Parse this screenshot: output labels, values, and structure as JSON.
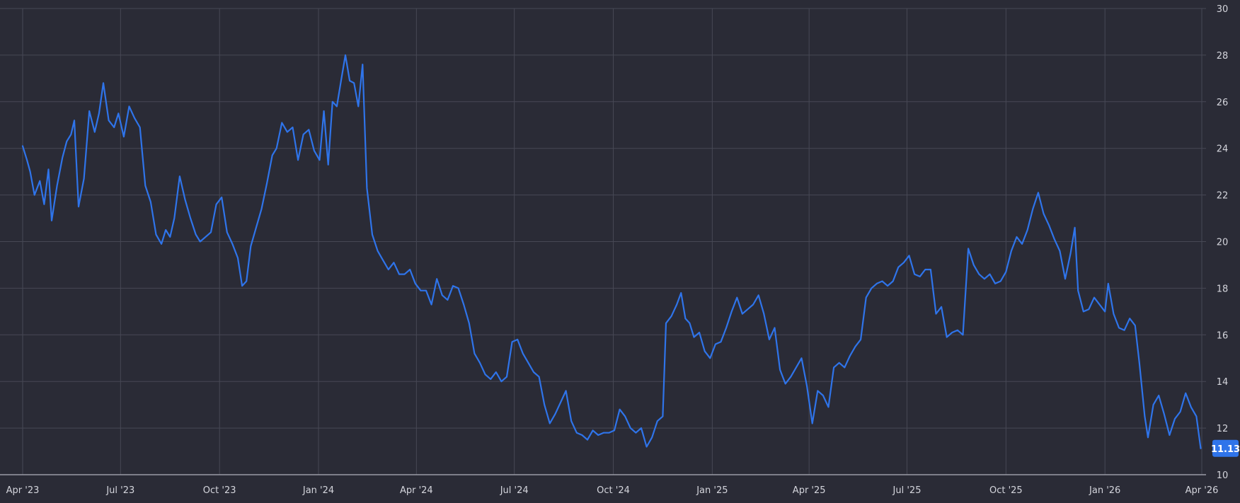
{
  "colors": {
    "background": "#2a2b36",
    "grid": "#474855",
    "line": "#2f74ea",
    "label": "#d4d5dc"
  },
  "chart_data": {
    "type": "line",
    "title": "",
    "xlabel": "",
    "ylabel": "",
    "ylim": [
      10,
      30
    ],
    "yticks": [
      10,
      12,
      14,
      16,
      18,
      20,
      22,
      24,
      26,
      28,
      30
    ],
    "xlim": [
      "2023-04-01",
      "2026-04-01"
    ],
    "xticks": [
      {
        "date": "2023-04-01",
        "label": "Apr '23"
      },
      {
        "date": "2023-07-01",
        "label": "Jul '23"
      },
      {
        "date": "2023-10-01",
        "label": "Oct '23"
      },
      {
        "date": "2024-01-01",
        "label": "Jan '24"
      },
      {
        "date": "2024-04-01",
        "label": "Apr '24"
      },
      {
        "date": "2024-07-01",
        "label": "Jul '24"
      },
      {
        "date": "2024-10-01",
        "label": "Oct '24"
      },
      {
        "date": "2025-01-01",
        "label": "Jan '25"
      },
      {
        "date": "2025-04-01",
        "label": "Apr '25"
      },
      {
        "date": "2025-07-01",
        "label": "Jul '25"
      },
      {
        "date": "2025-10-01",
        "label": "Oct '25"
      },
      {
        "date": "2026-01-01",
        "label": "Jan '26"
      },
      {
        "date": "2026-04-01",
        "label": "Apr '26"
      }
    ],
    "grid": true,
    "current_value": "11.13",
    "series": [
      {
        "points": [
          [
            "2023-04-01",
            24.1
          ],
          [
            "2023-04-05",
            23.5
          ],
          [
            "2023-04-08",
            23.0
          ],
          [
            "2023-04-12",
            22.0
          ],
          [
            "2023-04-17",
            22.6
          ],
          [
            "2023-04-21",
            21.6
          ],
          [
            "2023-04-25",
            23.1
          ],
          [
            "2023-04-28",
            20.9
          ],
          [
            "2023-05-03",
            22.4
          ],
          [
            "2023-05-08",
            23.6
          ],
          [
            "2023-05-12",
            24.3
          ],
          [
            "2023-05-16",
            24.6
          ],
          [
            "2023-05-19",
            25.2
          ],
          [
            "2023-05-23",
            21.5
          ],
          [
            "2023-05-28",
            22.7
          ],
          [
            "2023-06-02",
            25.6
          ],
          [
            "2023-06-07",
            24.7
          ],
          [
            "2023-06-11",
            25.5
          ],
          [
            "2023-06-15",
            26.8
          ],
          [
            "2023-06-20",
            25.2
          ],
          [
            "2023-06-25",
            24.9
          ],
          [
            "2023-06-29",
            25.5
          ],
          [
            "2023-07-04",
            24.5
          ],
          [
            "2023-07-09",
            25.8
          ],
          [
            "2023-07-14",
            25.3
          ],
          [
            "2023-07-19",
            24.9
          ],
          [
            "2023-07-24",
            22.4
          ],
          [
            "2023-07-29",
            21.7
          ],
          [
            "2023-08-03",
            20.3
          ],
          [
            "2023-08-08",
            19.9
          ],
          [
            "2023-08-12",
            20.5
          ],
          [
            "2023-08-16",
            20.2
          ],
          [
            "2023-08-20",
            21.0
          ],
          [
            "2023-08-25",
            22.8
          ],
          [
            "2023-08-30",
            21.8
          ],
          [
            "2023-09-04",
            21.0
          ],
          [
            "2023-09-09",
            20.3
          ],
          [
            "2023-09-13",
            20.0
          ],
          [
            "2023-09-18",
            20.2
          ],
          [
            "2023-09-23",
            20.4
          ],
          [
            "2023-09-28",
            21.6
          ],
          [
            "2023-10-03",
            21.9
          ],
          [
            "2023-10-08",
            20.4
          ],
          [
            "2023-10-13",
            19.9
          ],
          [
            "2023-10-18",
            19.3
          ],
          [
            "2023-10-22",
            18.1
          ],
          [
            "2023-10-26",
            18.3
          ],
          [
            "2023-10-30",
            19.8
          ],
          [
            "2023-11-04",
            20.6
          ],
          [
            "2023-11-09",
            21.4
          ],
          [
            "2023-11-14",
            22.5
          ],
          [
            "2023-11-19",
            23.7
          ],
          [
            "2023-11-23",
            24.0
          ],
          [
            "2023-11-28",
            25.1
          ],
          [
            "2023-12-03",
            24.7
          ],
          [
            "2023-12-08",
            24.9
          ],
          [
            "2023-12-13",
            23.5
          ],
          [
            "2023-12-18",
            24.6
          ],
          [
            "2023-12-23",
            24.8
          ],
          [
            "2023-12-28",
            23.9
          ],
          [
            "2024-01-02",
            23.5
          ],
          [
            "2024-01-06",
            25.6
          ],
          [
            "2024-01-10",
            23.3
          ],
          [
            "2024-01-14",
            26.0
          ],
          [
            "2024-01-18",
            25.8
          ],
          [
            "2024-01-22",
            26.9
          ],
          [
            "2024-01-26",
            28.0
          ],
          [
            "2024-01-30",
            26.9
          ],
          [
            "2024-02-03",
            26.8
          ],
          [
            "2024-02-07",
            25.8
          ],
          [
            "2024-02-11",
            27.6
          ],
          [
            "2024-02-15",
            22.3
          ],
          [
            "2024-02-20",
            20.3
          ],
          [
            "2024-02-25",
            19.6
          ],
          [
            "2024-03-01",
            19.2
          ],
          [
            "2024-03-06",
            18.8
          ],
          [
            "2024-03-11",
            19.1
          ],
          [
            "2024-03-16",
            18.6
          ],
          [
            "2024-03-21",
            18.6
          ],
          [
            "2024-03-26",
            18.8
          ],
          [
            "2024-03-31",
            18.2
          ],
          [
            "2024-04-05",
            17.9
          ],
          [
            "2024-04-10",
            17.9
          ],
          [
            "2024-04-15",
            17.3
          ],
          [
            "2024-04-20",
            18.4
          ],
          [
            "2024-04-25",
            17.7
          ],
          [
            "2024-04-30",
            17.5
          ],
          [
            "2024-05-05",
            18.1
          ],
          [
            "2024-05-10",
            18.0
          ],
          [
            "2024-05-15",
            17.3
          ],
          [
            "2024-05-20",
            16.5
          ],
          [
            "2024-05-25",
            15.2
          ],
          [
            "2024-05-30",
            14.8
          ],
          [
            "2024-06-04",
            14.3
          ],
          [
            "2024-06-09",
            14.1
          ],
          [
            "2024-06-14",
            14.4
          ],
          [
            "2024-06-19",
            14.0
          ],
          [
            "2024-06-24",
            14.2
          ],
          [
            "2024-06-29",
            15.7
          ],
          [
            "2024-07-04",
            15.8
          ],
          [
            "2024-07-09",
            15.2
          ],
          [
            "2024-07-14",
            14.8
          ],
          [
            "2024-07-19",
            14.4
          ],
          [
            "2024-07-24",
            14.2
          ],
          [
            "2024-07-29",
            13.0
          ],
          [
            "2024-08-03",
            12.2
          ],
          [
            "2024-08-08",
            12.6
          ],
          [
            "2024-08-13",
            13.1
          ],
          [
            "2024-08-18",
            13.6
          ],
          [
            "2024-08-23",
            12.3
          ],
          [
            "2024-08-28",
            11.8
          ],
          [
            "2024-09-02",
            11.7
          ],
          [
            "2024-09-07",
            11.5
          ],
          [
            "2024-09-12",
            11.9
          ],
          [
            "2024-09-17",
            11.7
          ],
          [
            "2024-09-22",
            11.8
          ],
          [
            "2024-09-27",
            11.8
          ],
          [
            "2024-10-02",
            11.9
          ],
          [
            "2024-10-07",
            12.8
          ],
          [
            "2024-10-12",
            12.5
          ],
          [
            "2024-10-17",
            12.0
          ],
          [
            "2024-10-22",
            11.8
          ],
          [
            "2024-10-27",
            12.0
          ],
          [
            "2024-11-01",
            11.2
          ],
          [
            "2024-11-06",
            11.6
          ],
          [
            "2024-11-11",
            12.3
          ],
          [
            "2024-11-16",
            12.5
          ],
          [
            "2024-11-19",
            16.5
          ],
          [
            "2024-11-24",
            16.8
          ],
          [
            "2024-11-29",
            17.3
          ],
          [
            "2024-12-03",
            17.8
          ],
          [
            "2024-12-07",
            16.7
          ],
          [
            "2024-12-11",
            16.5
          ],
          [
            "2024-12-15",
            15.9
          ],
          [
            "2024-12-20",
            16.1
          ],
          [
            "2024-12-25",
            15.3
          ],
          [
            "2024-12-30",
            15.0
          ],
          [
            "2025-01-04",
            15.6
          ],
          [
            "2025-01-09",
            15.7
          ],
          [
            "2025-01-14",
            16.3
          ],
          [
            "2025-01-19",
            17.0
          ],
          [
            "2025-01-24",
            17.6
          ],
          [
            "2025-01-29",
            16.9
          ],
          [
            "2025-02-03",
            17.1
          ],
          [
            "2025-02-08",
            17.3
          ],
          [
            "2025-02-13",
            17.7
          ],
          [
            "2025-02-18",
            16.9
          ],
          [
            "2025-02-23",
            15.8
          ],
          [
            "2025-02-28",
            16.3
          ],
          [
            "2025-03-05",
            14.5
          ],
          [
            "2025-03-10",
            13.9
          ],
          [
            "2025-03-15",
            14.2
          ],
          [
            "2025-03-20",
            14.6
          ],
          [
            "2025-03-25",
            15.0
          ],
          [
            "2025-03-30",
            13.8
          ],
          [
            "2025-04-04",
            12.2
          ],
          [
            "2025-04-09",
            13.6
          ],
          [
            "2025-04-14",
            13.4
          ],
          [
            "2025-04-19",
            12.9
          ],
          [
            "2025-04-24",
            14.6
          ],
          [
            "2025-04-29",
            14.8
          ],
          [
            "2025-05-04",
            14.6
          ],
          [
            "2025-05-09",
            15.1
          ],
          [
            "2025-05-14",
            15.5
          ],
          [
            "2025-05-19",
            15.8
          ],
          [
            "2025-05-24",
            17.6
          ],
          [
            "2025-05-29",
            18.0
          ],
          [
            "2025-06-03",
            18.2
          ],
          [
            "2025-06-08",
            18.3
          ],
          [
            "2025-06-13",
            18.1
          ],
          [
            "2025-06-18",
            18.3
          ],
          [
            "2025-06-23",
            18.9
          ],
          [
            "2025-06-28",
            19.1
          ],
          [
            "2025-07-03",
            19.4
          ],
          [
            "2025-07-08",
            18.6
          ],
          [
            "2025-07-13",
            18.5
          ],
          [
            "2025-07-18",
            18.8
          ],
          [
            "2025-07-23",
            18.8
          ],
          [
            "2025-07-28",
            16.9
          ],
          [
            "2025-08-02",
            17.2
          ],
          [
            "2025-08-07",
            15.9
          ],
          [
            "2025-08-12",
            16.1
          ],
          [
            "2025-08-17",
            16.2
          ],
          [
            "2025-08-22",
            16.0
          ],
          [
            "2025-08-27",
            19.7
          ],
          [
            "2025-09-01",
            19.0
          ],
          [
            "2025-09-06",
            18.6
          ],
          [
            "2025-09-11",
            18.4
          ],
          [
            "2025-09-16",
            18.6
          ],
          [
            "2025-09-21",
            18.2
          ],
          [
            "2025-09-26",
            18.3
          ],
          [
            "2025-10-01",
            18.7
          ],
          [
            "2025-10-06",
            19.6
          ],
          [
            "2025-10-11",
            20.2
          ],
          [
            "2025-10-16",
            19.9
          ],
          [
            "2025-10-21",
            20.5
          ],
          [
            "2025-10-26",
            21.4
          ],
          [
            "2025-10-31",
            22.1
          ],
          [
            "2025-11-05",
            21.2
          ],
          [
            "2025-11-10",
            20.7
          ],
          [
            "2025-11-15",
            20.1
          ],
          [
            "2025-11-20",
            19.6
          ],
          [
            "2025-11-25",
            18.4
          ],
          [
            "2025-11-30",
            19.5
          ],
          [
            "2025-12-04",
            20.6
          ],
          [
            "2025-12-07",
            17.9
          ],
          [
            "2025-12-12",
            17.0
          ],
          [
            "2025-12-17",
            17.1
          ],
          [
            "2025-12-22",
            17.6
          ],
          [
            "2025-12-27",
            17.3
          ],
          [
            "2026-01-01",
            17.0
          ],
          [
            "2026-01-04",
            18.2
          ],
          [
            "2026-01-09",
            16.9
          ],
          [
            "2026-01-14",
            16.3
          ],
          [
            "2026-01-19",
            16.2
          ],
          [
            "2026-01-24",
            16.7
          ],
          [
            "2026-01-29",
            16.4
          ],
          [
            "2026-02-02",
            14.8
          ],
          [
            "2026-02-07",
            12.5
          ],
          [
            "2026-02-10",
            11.6
          ],
          [
            "2026-02-15",
            13.0
          ],
          [
            "2026-02-20",
            13.4
          ],
          [
            "2026-02-25",
            12.6
          ],
          [
            "2026-03-02",
            11.7
          ],
          [
            "2026-03-07",
            12.4
          ],
          [
            "2026-03-12",
            12.7
          ],
          [
            "2026-03-17",
            13.5
          ],
          [
            "2026-03-22",
            12.9
          ],
          [
            "2026-03-27",
            12.5
          ],
          [
            "2026-03-31",
            11.13
          ]
        ]
      }
    ]
  }
}
